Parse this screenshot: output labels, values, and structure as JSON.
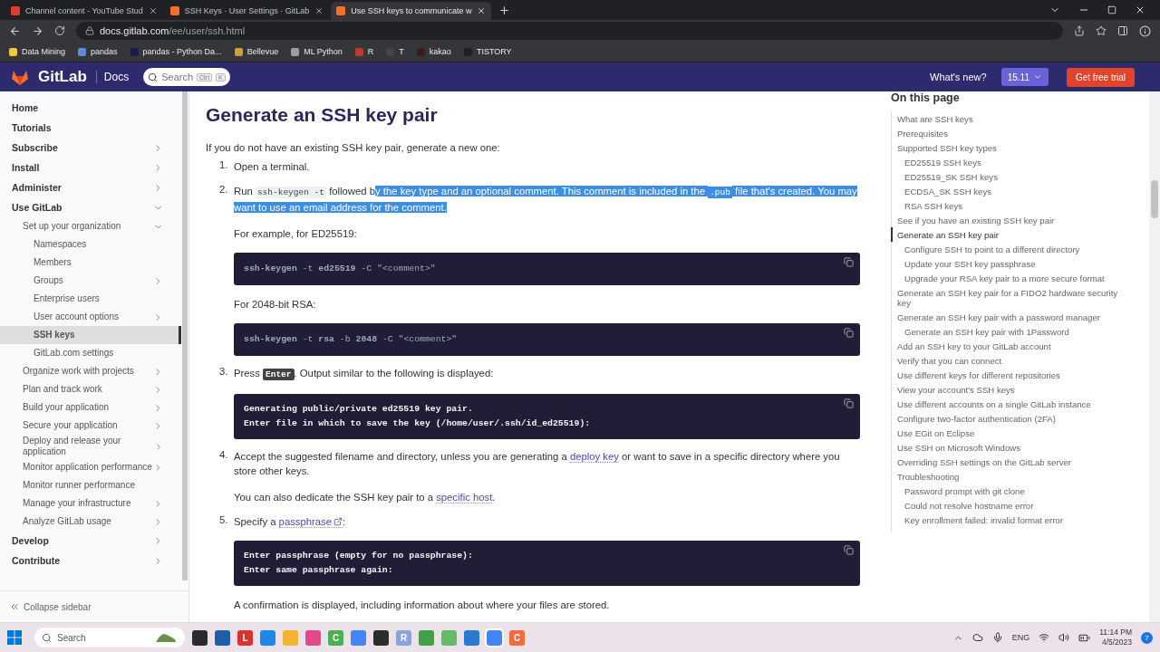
{
  "browser": {
    "tabs": [
      {
        "title": "Channel content - YouTube Stud",
        "selected": false,
        "color": "#e53935"
      },
      {
        "title": "SSH Keys · User Settings · GitLab",
        "selected": false,
        "color": "#fc6d26"
      },
      {
        "title": "Use SSH keys to communicate w",
        "selected": true,
        "color": "#fc6d26"
      }
    ],
    "url": {
      "host": "docs.gitlab.com",
      "path": "/ee/user/ssh.html"
    },
    "bookmarks": [
      {
        "label": "Data Mining",
        "color": "#f4c542"
      },
      {
        "label": "pandas",
        "color": "#5b8bd6"
      },
      {
        "label": "pandas - Python Da...",
        "color": "#1b1b4d"
      },
      {
        "label": "Bellevue",
        "color": "#c9a23a"
      },
      {
        "label": "ML Python",
        "color": "#9e9e9e"
      },
      {
        "label": "R",
        "color": "#c0392b"
      },
      {
        "label": "T",
        "color": "#444444"
      },
      {
        "label": "kakao",
        "color": "#3a1d1d"
      },
      {
        "label": "TISTORY",
        "color": "#202124"
      }
    ]
  },
  "header": {
    "logo": "GitLab",
    "section": "Docs",
    "search": {
      "placeholder": "Search",
      "keys": [
        "Ctrl",
        "K"
      ]
    },
    "whats_new": "What's new?",
    "version": "15.11",
    "cta": "Get free trial"
  },
  "sidebar": {
    "items": [
      {
        "label": "Home",
        "selected": false
      },
      {
        "label": "Tutorials",
        "selected": false
      },
      {
        "label": "Subscribe",
        "selected": false,
        "expanded": false
      },
      {
        "label": "Install",
        "selected": false,
        "expanded": false
      },
      {
        "label": "Administer",
        "selected": false,
        "expanded": false
      },
      {
        "label": "Use GitLab",
        "selected": false,
        "expanded": true,
        "children": [
          {
            "label": "Set up your organization",
            "selected": false,
            "expanded": true,
            "children": [
              {
                "label": "Namespaces",
                "selected": false
              },
              {
                "label": "Members",
                "selected": false
              },
              {
                "label": "Groups",
                "selected": false,
                "expanded": false
              },
              {
                "label": "Enterprise users",
                "selected": false
              },
              {
                "label": "User account options",
                "selected": false,
                "expanded": false
              },
              {
                "label": "SSH keys",
                "selected": true
              },
              {
                "label": "GitLab.com settings",
                "selected": false
              }
            ]
          },
          {
            "label": "Organize work with projects",
            "selected": false,
            "expanded": false
          },
          {
            "label": "Plan and track work",
            "selected": false,
            "expanded": false
          },
          {
            "label": "Build your application",
            "selected": false,
            "expanded": false
          },
          {
            "label": "Secure your application",
            "selected": false,
            "expanded": false
          },
          {
            "label": "Deploy and release your application",
            "selected": false,
            "expanded": false
          },
          {
            "label": "Monitor application performance",
            "selected": false,
            "expanded": false
          },
          {
            "label": "Monitor runner performance",
            "selected": false
          },
          {
            "label": "Manage your infrastructure",
            "selected": false,
            "expanded": false
          },
          {
            "label": "Analyze GitLab usage",
            "selected": false,
            "expanded": false
          }
        ]
      },
      {
        "label": "Develop",
        "selected": false,
        "expanded": false
      },
      {
        "label": "Contribute",
        "selected": false,
        "expanded": false
      }
    ],
    "collapse": "Collapse sidebar"
  },
  "article": {
    "title": "Generate an SSH key pair",
    "intro": "If you do not have an existing SSH key pair, generate a new one:",
    "steps": [
      {
        "number": "1.",
        "blocks": [
          {
            "kind": "para",
            "segments": [
              {
                "kind": "text",
                "text": "Open a terminal."
              }
            ]
          }
        ]
      },
      {
        "number": "2.",
        "blocks": [
          {
            "kind": "para",
            "segments": [
              {
                "kind": "text",
                "text": "Run ",
                "highlighted": false
              },
              {
                "kind": "code",
                "text": "ssh-keygen -t",
                "highlighted": false
              },
              {
                "kind": "text",
                "text": " followed b",
                "highlighted": false
              },
              {
                "kind": "text",
                "text": "y the key type and an optional comment. This comment is included in the ",
                "highlighted": true
              },
              {
                "kind": "code",
                "text": ".pub",
                "highlighted": true
              },
              {
                "kind": "text",
                "text": " file that's created. You may want to use an email address for the comment.",
                "highlighted": true
              }
            ]
          },
          {
            "kind": "para",
            "segments": [
              {
                "kind": "text",
                "text": "For example, for ED25519:"
              }
            ]
          },
          {
            "kind": "command",
            "lines": [
              "**ssh-keygen** -t **ed25519** -C \"<comment>\""
            ]
          },
          {
            "kind": "para",
            "segments": [
              {
                "kind": "text",
                "text": "For 2048-bit RSA:"
              }
            ]
          },
          {
            "kind": "command",
            "lines": [
              "**ssh-keygen** -t **rsa** -b **2048** -C \"<comment>\""
            ]
          }
        ]
      },
      {
        "number": "3.",
        "blocks": [
          {
            "kind": "para",
            "segments": [
              {
                "kind": "text",
                "text": "Press "
              },
              {
                "kind": "key",
                "text": "Enter"
              },
              {
                "kind": "text",
                "text": ". Output similar to the following is displayed:"
              }
            ]
          },
          {
            "kind": "output",
            "lines": [
              "Generating public/private ed25519 key pair.",
              "Enter file in which to save the key (/home/user/.ssh/id_ed25519):"
            ]
          }
        ]
      },
      {
        "number": "4.",
        "blocks": [
          {
            "kind": "para",
            "segments": [
              {
                "kind": "text",
                "text": "Accept the suggested filename and directory, unless you are generating a "
              },
              {
                "kind": "link",
                "text": "deploy key",
                "external": false
              },
              {
                "kind": "text",
                "text": " or want to save in a specific directory where you store other keys."
              }
            ]
          },
          {
            "kind": "para",
            "segments": [
              {
                "kind": "text",
                "text": "You can also dedicate the SSH key pair to a "
              },
              {
                "kind": "link",
                "text": "specific host",
                "external": false
              },
              {
                "kind": "text",
                "text": "."
              }
            ]
          }
        ]
      },
      {
        "number": "5.",
        "blocks": [
          {
            "kind": "para",
            "segments": [
              {
                "kind": "text",
                "text": "Specify a "
              },
              {
                "kind": "link",
                "text": "passphrase",
                "external": true
              },
              {
                "kind": "text",
                "text": ":"
              }
            ]
          },
          {
            "kind": "output",
            "lines": [
              "Enter passphrase (empty for no passphrase):",
              "Enter same passphrase again:"
            ]
          },
          {
            "kind": "para",
            "segments": [
              {
                "kind": "text",
                "text": "A confirmation is displayed, including information about where your files are stored."
              }
            ]
          }
        ]
      }
    ]
  },
  "toc": {
    "title": "On this page",
    "items": [
      {
        "label": "What are SSH keys",
        "selected": false
      },
      {
        "label": "Prerequisites",
        "selected": false
      },
      {
        "label": "Supported SSH key types",
        "selected": false,
        "children": [
          {
            "label": "ED25519 SSH keys",
            "selected": false
          },
          {
            "label": "ED25519_SK SSH keys",
            "selected": false
          },
          {
            "label": "ECDSA_SK SSH keys",
            "selected": false
          },
          {
            "label": "RSA SSH keys",
            "selected": false
          }
        ]
      },
      {
        "label": "See if you have an existing SSH key pair",
        "selected": false
      },
      {
        "label": "Generate an SSH key pair",
        "selected": true,
        "children": [
          {
            "label": "Configure SSH to point to a different directory",
            "selected": false
          },
          {
            "label": "Update your SSH key passphrase",
            "selected": false
          },
          {
            "label": "Upgrade your RSA key pair to a more secure format",
            "selected": false
          }
        ]
      },
      {
        "label": "Generate an SSH key pair for a FIDO2 hardware security key",
        "selected": false
      },
      {
        "label": "Generate an SSH key pair with a password manager",
        "selected": false,
        "children": [
          {
            "label": "Generate an SSH key pair with 1Password",
            "selected": false
          }
        ]
      },
      {
        "label": "Add an SSH key to your GitLab account",
        "selected": false
      },
      {
        "label": "Verify that you can connect",
        "selected": false
      },
      {
        "label": "Use different keys for different repositories",
        "selected": false
      },
      {
        "label": "View your account's SSH keys",
        "selected": false
      },
      {
        "label": "Use different accounts on a single GitLab instance",
        "selected": false
      },
      {
        "label": "Configure two-factor authentication (2FA)",
        "selected": false
      },
      {
        "label": "Use EGit on Eclipse",
        "selected": false
      },
      {
        "label": "Use SSH on Microsoft Windows",
        "selected": false
      },
      {
        "label": "Overriding SSH settings on the GitLab server",
        "selected": false
      },
      {
        "label": "Troubleshooting",
        "selected": false,
        "children": [
          {
            "label": "Password prompt with git clone",
            "selected": false
          },
          {
            "label": "Could not resolve hostname error",
            "selected": false
          },
          {
            "label": "Key enrollment failed: invalid format error",
            "selected": false
          }
        ]
      }
    ]
  },
  "taskbar": {
    "search": {
      "placeholder": "Search"
    },
    "apps": [
      {
        "color": "#2b2b2b",
        "selected": false
      },
      {
        "color": "#1f5fa8",
        "selected": false
      },
      {
        "color": "#d9342b",
        "glyph": "L",
        "selected": false
      },
      {
        "color": "#1e88e5",
        "selected": false
      },
      {
        "color": "#f2b533",
        "selected": false
      },
      {
        "color": "#e04a8a",
        "selected": false
      },
      {
        "color": "#4caf50",
        "glyph": "C",
        "selected": false
      },
      {
        "color": "#4285f4",
        "selected": false
      },
      {
        "color": "#2d2d2d",
        "selected": false
      },
      {
        "color": "#8aa4d6",
        "glyph": "R",
        "selected": false
      },
      {
        "color": "#43a047",
        "selected": false
      },
      {
        "color": "#66bb6a",
        "selected": false
      },
      {
        "color": "#2a7ad1",
        "selected": false
      },
      {
        "color": "#4285f4",
        "selected": true
      },
      {
        "color": "#f26b3a",
        "glyph": "C",
        "selected": false
      }
    ],
    "language": "ENG",
    "time": "11:14 PM",
    "date": "4/5/2023",
    "notifications": "7"
  }
}
